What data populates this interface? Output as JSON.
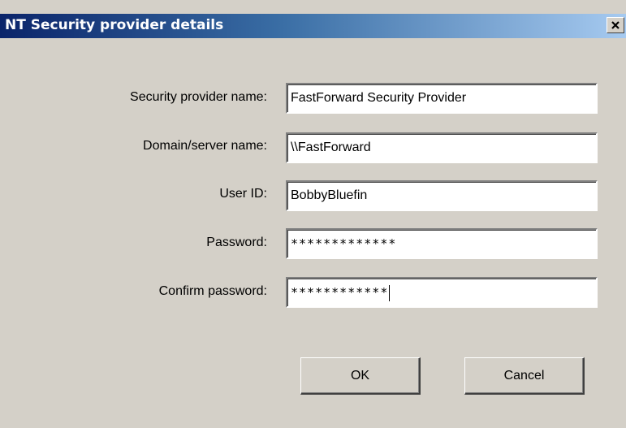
{
  "window": {
    "title": "NT Security provider details",
    "close_icon": "close-icon"
  },
  "form": {
    "provider_name": {
      "label": "Security provider name:",
      "value": "FastForward Security Provider"
    },
    "domain": {
      "label": "Domain/server name:",
      "value": "\\\\FastForward"
    },
    "user_id": {
      "label": "User ID:",
      "value": "BobbyBluefin"
    },
    "password": {
      "label": "Password:",
      "value": "*************"
    },
    "confirm_password": {
      "label": "Confirm password:",
      "value": "************"
    }
  },
  "buttons": {
    "ok": "OK",
    "cancel": "Cancel"
  },
  "colors": {
    "dialog_bg": "#d4d0c8",
    "title_start": "#0a246a",
    "title_end": "#a6caf0"
  }
}
